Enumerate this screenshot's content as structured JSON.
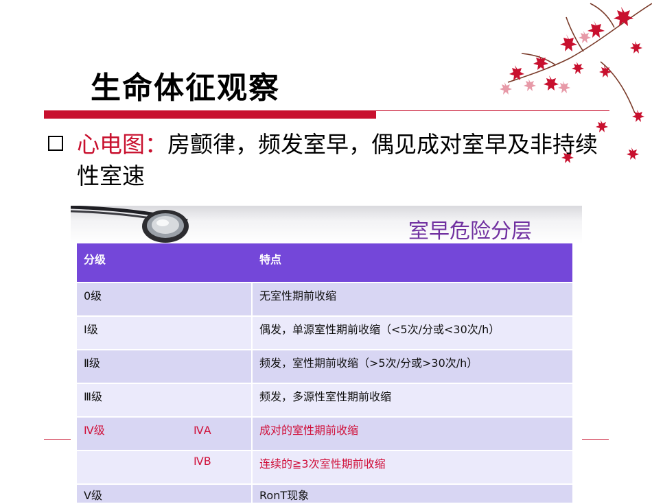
{
  "slide": {
    "title": "生命体征观察",
    "bullet_label": "心电图：",
    "bullet_text": "房颤律，频发室早，偶见成对室早及非持续性室速"
  },
  "panel": {
    "title": "室早危险分层",
    "headers": [
      "分级",
      "特点"
    ],
    "rows": [
      {
        "level": "0级",
        "sub": "",
        "desc": "无室性期前收缩"
      },
      {
        "level": "Ⅰ级",
        "sub": "",
        "desc": "偶发，单源室性期前收缩（<5次/分或<30次/h）"
      },
      {
        "level": "Ⅱ级",
        "sub": "",
        "desc": "频发，室性期前收缩（>5次/分或>30次/h）"
      },
      {
        "level": "Ⅲ级",
        "sub": "",
        "desc": "频发，多源性室性期前收缩"
      },
      {
        "level": "Ⅳ级",
        "sub": "ⅣA",
        "desc": "成对的室性期前收缩"
      },
      {
        "level": "",
        "sub": "ⅣB",
        "desc": "连续的≧3次室性期前收缩"
      },
      {
        "level": "Ⅴ级",
        "sub": "",
        "desc": "RonT现象"
      }
    ]
  },
  "colors": {
    "accent_red": "#c8102e",
    "table_header": "#7447d9",
    "panel_title": "#7030a0"
  },
  "icons": [
    "maple-leaves-decoration",
    "stethoscope-image",
    "checkbox-bullet-icon"
  ]
}
